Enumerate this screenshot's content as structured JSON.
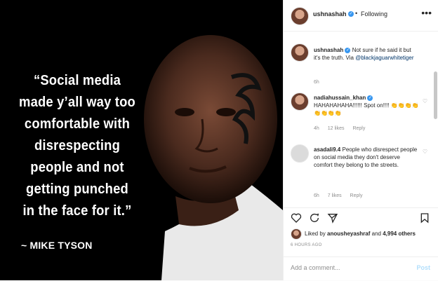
{
  "image": {
    "quote": "“Social media\nmade y’all way too\ncomfortable with\ndisrespecting\npeople and not\ngetting punched\nin the face for it.”",
    "attribution": "~ MIKE TYSON"
  },
  "header": {
    "username": "ushnashah",
    "dot": "•",
    "follow_status": "Following",
    "more_icon": "more-options-icon"
  },
  "comments": [
    {
      "username": "ushnashah",
      "text": "Not sure if he said it but it's the truth. Via",
      "mention": "@blackjaguarwhitetiger",
      "time": "6h"
    },
    {
      "username": "nadiahussain_khan",
      "text": "HAHAHAHAHA!!!!!! Spot on!!!! 👏👏👏👏👏👏👏👏",
      "time": "4h",
      "likes": "12 likes",
      "reply": "Reply"
    },
    {
      "username": "asadali9.4",
      "text": "People who disrespect people on social media they don't deserve comfort they belong to the streets.",
      "time": "6h",
      "likes": "7 likes",
      "reply": "Reply"
    }
  ],
  "likes": {
    "prefix": "Liked by",
    "user": "anousheyashraf",
    "suffix": "and",
    "count": "4,994 others"
  },
  "posted": "6 HOURS AGO",
  "add_comment": {
    "placeholder": "Add a comment...",
    "post_label": "Post"
  },
  "colors": {
    "verified": "#3897f0",
    "link": "#003569",
    "post_disabled": "#b2dffc"
  }
}
